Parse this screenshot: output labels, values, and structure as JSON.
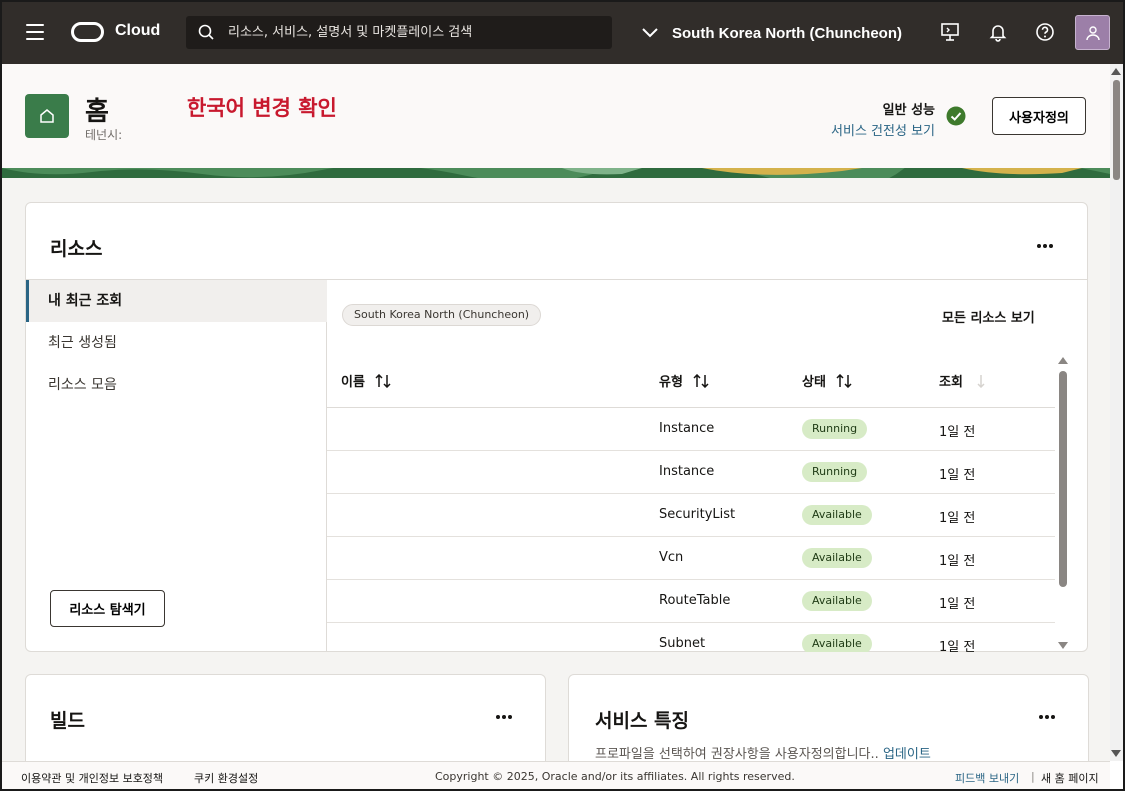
{
  "topbar": {
    "logo_text": "Cloud",
    "search_placeholder": "리소스, 서비스, 설명서 및 마켓플레이스 검색",
    "region": "South Korea North (Chuncheon)",
    "icons": [
      "menu-icon",
      "search-icon",
      "chevron-down-icon",
      "developer-tools-icon",
      "bell-icon",
      "help-icon",
      "user-icon"
    ]
  },
  "header": {
    "title": "홈",
    "subtitle": "테넌시:",
    "notice": "한국어 변경 확인",
    "health_label": "일반 성능",
    "health_link": "서비스 건전성 보기",
    "customize_label": "사용자정의"
  },
  "resources": {
    "title": "리소스",
    "tabs": [
      {
        "label": "내 최근 조회",
        "active": true
      },
      {
        "label": "최근 생성됨",
        "active": false
      },
      {
        "label": "리소스 모음",
        "active": false
      }
    ],
    "explorer_label": "리소스 탐색기",
    "filter_chip": "South Korea North (Chuncheon)",
    "view_all": "모든 리소스 보기",
    "columns": [
      "이름",
      "유형",
      "상태",
      "조회"
    ],
    "rows": [
      {
        "name": "",
        "type": "Instance",
        "state": "Running",
        "viewed": "1일 전"
      },
      {
        "name": "",
        "type": "Instance",
        "state": "Running",
        "viewed": "1일 전"
      },
      {
        "name": "",
        "type": "SecurityList",
        "state": "Available",
        "viewed": "1일 전"
      },
      {
        "name": "",
        "type": "Vcn",
        "state": "Available",
        "viewed": "1일 전"
      },
      {
        "name": "",
        "type": "RouteTable",
        "state": "Available",
        "viewed": "1일 전"
      },
      {
        "name": "",
        "type": "Subnet",
        "state": "Available",
        "viewed": "1일 전"
      }
    ]
  },
  "build": {
    "title": "빌드"
  },
  "service_features": {
    "title": "서비스 특징",
    "description": "프로파일을 선택하여 권장사항을 사용자정의합니다..",
    "update_link": "업데이트"
  },
  "footer": {
    "terms": "이용약관 및 개인정보 보호정책",
    "cookies": "쿠키 환경설정",
    "copyright": "Copyright © 2025, Oracle and/or its affiliates. All rights reserved.",
    "feedback": "피드백 보내기",
    "new_home": "새 홈 페이지"
  },
  "colors": {
    "topbar": "#312d2a",
    "accent": "#2a6585",
    "notice": "#c8192e",
    "badge_bg": "#d7ebc6",
    "ok": "#3e7a2c"
  }
}
